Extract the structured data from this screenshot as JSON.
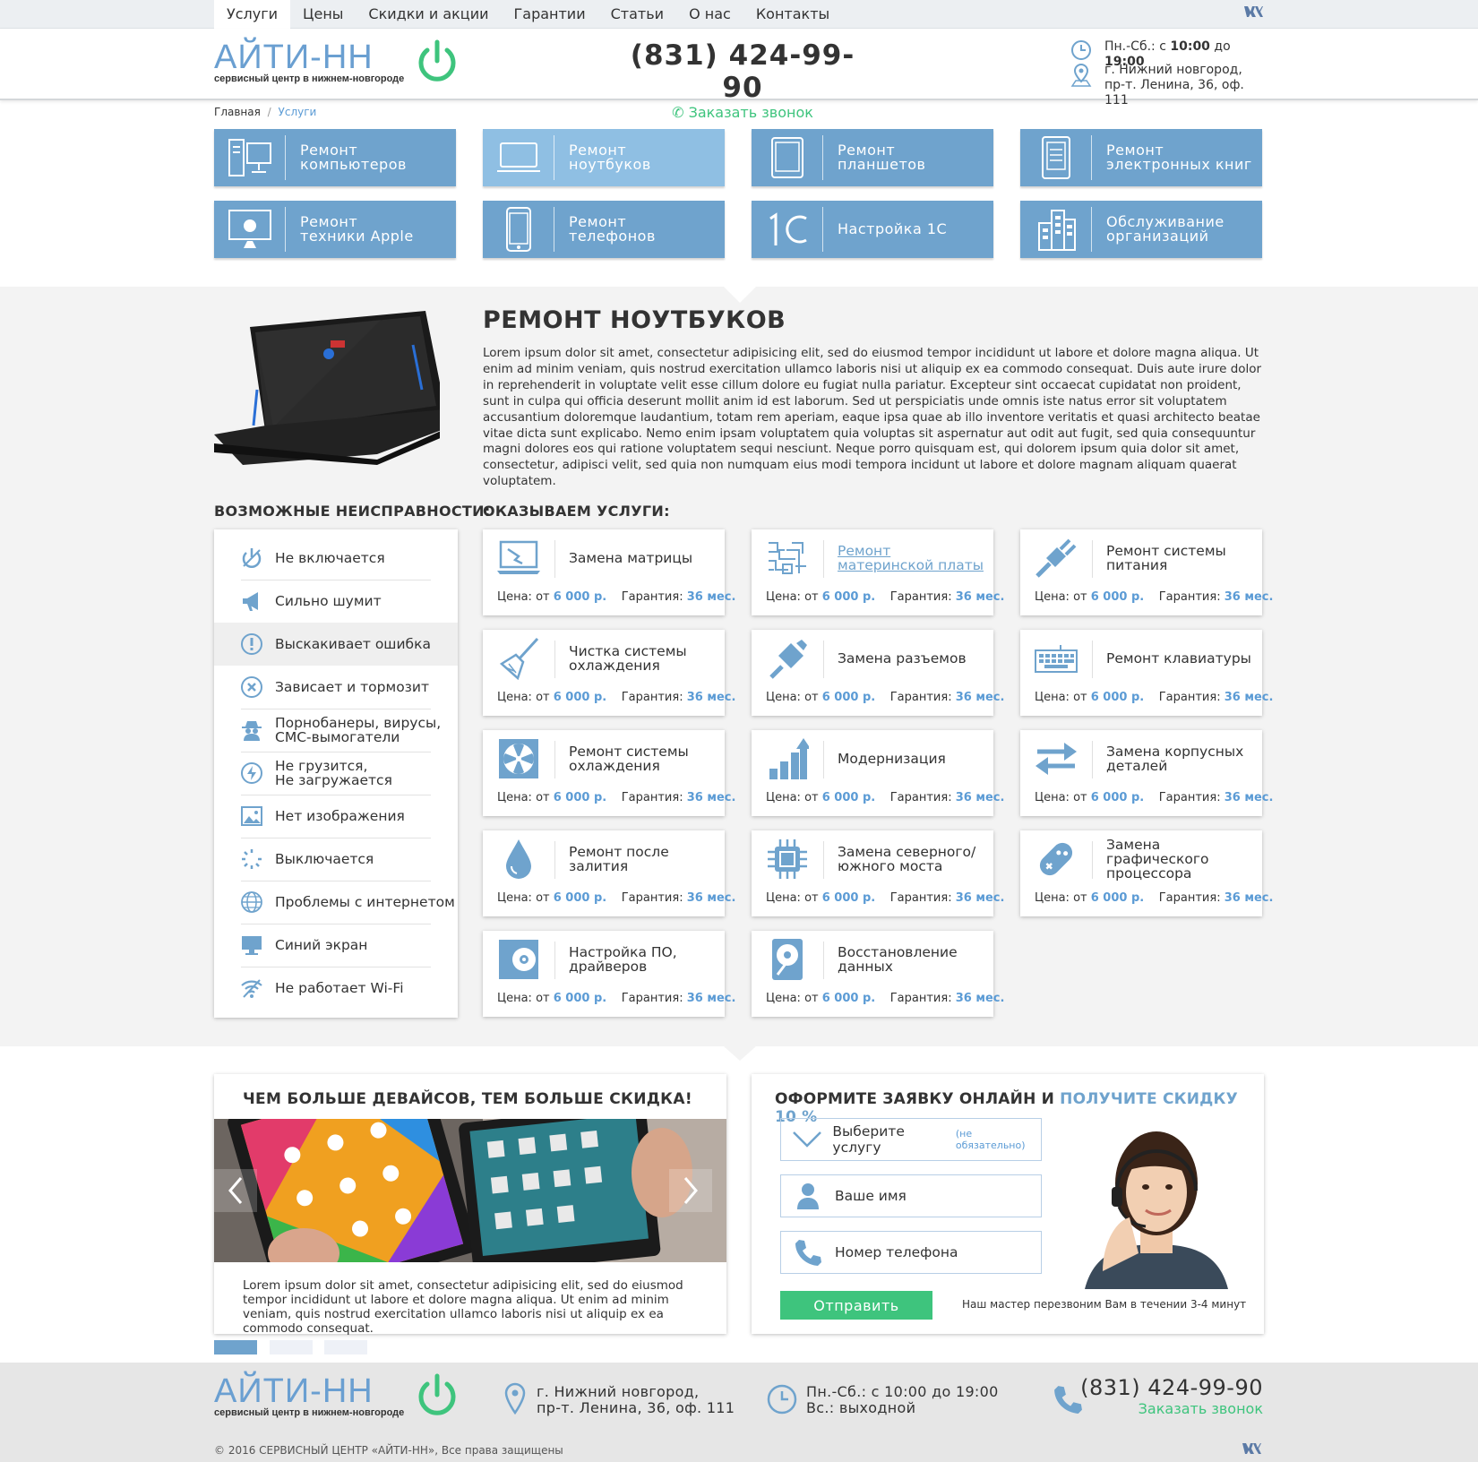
{
  "nav": {
    "items": [
      "Услуги",
      "Цены",
      "Скидки и акции",
      "Гарантии",
      "Статьи",
      "О нас",
      "Контакты"
    ],
    "vk": "vk"
  },
  "brand": {
    "name": "АЙТИ-НН",
    "subtitle": "сервисный центр в нижнем-новгороде"
  },
  "header": {
    "phone": "(831) 424-99-90",
    "callback": "Заказать звонок",
    "hours_prefix": "Пн.-Сб.: с ",
    "hours_from": "10:00",
    "hours_mid": " до ",
    "hours_to": "19:00",
    "address1": "г. Нижний новгород,",
    "address2": "пр-т. Ленина, 36, оф. 111"
  },
  "breadcrumb": {
    "home": "Главная",
    "sep": "/",
    "current": "Услуги"
  },
  "categories": [
    {
      "label": "Ремонт\nкомпьютеров",
      "icon": "computer-icon"
    },
    {
      "label": "Ремонт\nноутбуков",
      "icon": "laptop-icon"
    },
    {
      "label": "Ремонт\nпланшетов",
      "icon": "tablet-icon"
    },
    {
      "label": "Ремонт\nэлектронных книг",
      "icon": "ebook-icon"
    },
    {
      "label": "Ремонт\nтехники Apple",
      "icon": "apple-icon"
    },
    {
      "label": "Ремонт\nтелефонов",
      "icon": "phone-icon"
    },
    {
      "label": "Настройка 1С",
      "icon": "1c-icon"
    },
    {
      "label": "Обслуживание\nорганизаций",
      "icon": "building-icon"
    }
  ],
  "page": {
    "title": "РЕМОНТ НОУТБУКОВ",
    "description": "Lorem ipsum dolor sit amet, consectetur adipisicing elit, sed do eiusmod tempor incididunt ut labore et dolore magna aliqua. Ut enim ad minim veniam, quis nostrud exercitation ullamco laboris nisi ut aliquip ex ea commodo consequat. Duis aute irure dolor in reprehenderit in voluptate velit esse cillum dolore eu fugiat nulla pariatur. Excepteur sint occaecat cupidatat non proident, sunt in culpa qui officia deserunt mollit anim id est laborum. Sed ut perspiciatis unde omnis iste natus error sit voluptatem accusantium doloremque laudantium, totam rem aperiam, eaque ipsa quae ab illo inventore veritatis et quasi architecto beatae vitae dicta sunt explicabo. Nemo enim ipsam voluptatem quia voluptas sit aspernatur aut odit aut fugit, sed quia consequuntur magni dolores eos qui ratione voluptatem sequi nesciunt. Neque porro quisquam est, qui dolorem ipsum quia dolor sit amet, consectetur, adipisci velit, sed quia non numquam eius modi tempora incidunt ut labore et dolore magnam aliquam quaerat voluptatem."
  },
  "faults": {
    "heading": "ВОЗМОЖНЫЕ НЕИСПРАВНОСТИ:",
    "items": [
      {
        "label": "Не включается",
        "icon": "power-icon"
      },
      {
        "label": "Сильно шумит",
        "icon": "megaphone-icon"
      },
      {
        "label": "Выскакивает ошибка",
        "icon": "exclamation-icon"
      },
      {
        "label": "Зависает и тормозит",
        "icon": "x-circle-icon"
      },
      {
        "label": "Порнобанеры, вирусы,\nСМС-вымогатели",
        "icon": "spy-icon"
      },
      {
        "label": "Не грузится,\nНе загружается",
        "icon": "bolt-circle-icon"
      },
      {
        "label": "Нет изображения",
        "icon": "image-icon"
      },
      {
        "label": "Выключается",
        "icon": "loading-icon"
      },
      {
        "label": "Проблемы с интернетом",
        "icon": "globe-icon"
      },
      {
        "label": "Синий экран",
        "icon": "monitor-icon"
      },
      {
        "label": "Не работает Wi-Fi",
        "icon": "wifi-off-icon"
      }
    ]
  },
  "services": {
    "heading": "ОКАЗЫВАЕМ УСЛУГИ:",
    "price_label": "Цена: от ",
    "price": "6 000 р.",
    "warranty_label": "Гарантия: ",
    "warranty": "36 мес.",
    "items": [
      {
        "label": "Замена матрицы",
        "icon": "broken-screen-icon"
      },
      {
        "label": "Ремонт\nматеринской платы",
        "icon": "motherboard-icon",
        "link": true
      },
      {
        "label": "Ремонт системы\nпитания",
        "icon": "plug-icon"
      },
      {
        "label": "Чистка системы\nохлаждения",
        "icon": "broom-icon"
      },
      {
        "label": "Замена разъемов",
        "icon": "usb-icon"
      },
      {
        "label": "Ремонт клавиатуры",
        "icon": "keyboard-icon"
      },
      {
        "label": "Ремонт системы\nохлаждения",
        "icon": "fan-icon"
      },
      {
        "label": "Модернизация",
        "icon": "bars-up-icon"
      },
      {
        "label": "Замена корпусных\nдеталей",
        "icon": "swap-arrows-icon"
      },
      {
        "label": "Ремонт после\nзалития",
        "icon": "drop-icon"
      },
      {
        "label": "Замена северного/\nюжного моста",
        "icon": "chip-icon"
      },
      {
        "label": "Замена графического\nпроцессора",
        "icon": "gamepad-icon"
      },
      {
        "label": "Настройка ПО,\nдрайверов",
        "icon": "disc-icon"
      },
      {
        "label": "Восстановление\nданных",
        "icon": "hdd-icon"
      }
    ]
  },
  "promo": {
    "title": "ЧЕМ БОЛЬШЕ ДЕВАЙСОВ, ТЕМ БОЛЬШЕ СКИДКА!",
    "text": "Lorem ipsum dolor sit amet, consectetur adipisicing elit, sed do eiusmod tempor incididunt ut labore et dolore magna aliqua. Ut enim ad minim veniam, quis nostrud exercitation ullamco laboris nisi ut aliquip ex ea commodo consequat."
  },
  "order": {
    "title": "ОФОРМИТЕ ЗАЯВКУ ОНЛАЙН И ",
    "title_accent": "ПОЛУЧИТЕ СКИДКУ 10 %",
    "service": "Выберите услугу",
    "service_note": "(не обязательно)",
    "name": "Ваше имя",
    "phone": "Номер телефона",
    "submit": "Отправить",
    "note": "Наш мастер перезвоним Вам в течении 3-4 минут"
  },
  "footer": {
    "address1": "г. Нижний новгород,",
    "address2": "пр-т. Ленина, 36, оф. 111",
    "hours1": "Пн.-Сб.: с 10:00 до 19:00",
    "hours2": "Вс.: выходной",
    "phone": "(831) 424-99-90",
    "callback": "Заказать звонок",
    "copyright": "© 2016 СЕРВИСНЫЙ ЦЕНТР «АЙТИ-НН», Все права защищены"
  },
  "colors": {
    "accent": "#6fa3cd",
    "green": "#3ec47d",
    "link": "#5b9bd5"
  }
}
